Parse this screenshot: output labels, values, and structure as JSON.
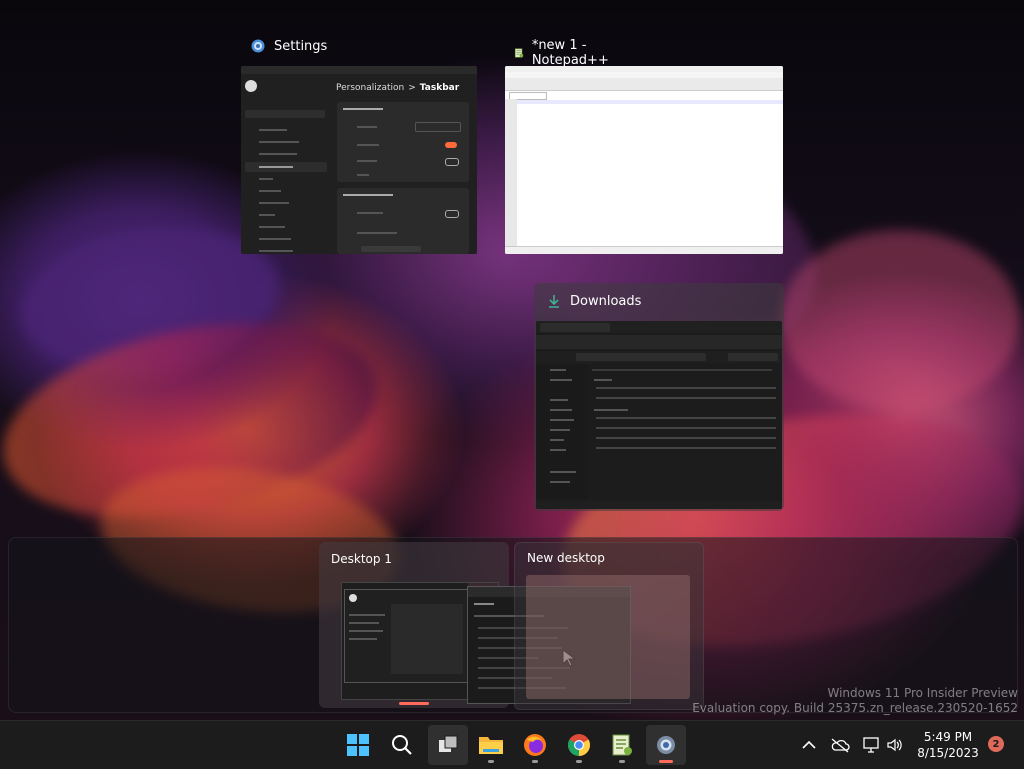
{
  "windows": [
    {
      "title": "Settings",
      "icon": "gear-icon"
    },
    {
      "title": "*new 1 - Notepad++",
      "icon": "notepadpp-icon"
    },
    {
      "title": "Downloads",
      "icon": "download-icon"
    }
  ],
  "settings_preview": {
    "breadcrumb_section": "Personalization",
    "breadcrumb_separator": ">",
    "breadcrumb_page": "Taskbar"
  },
  "desktops": [
    {
      "label": "Desktop 1"
    },
    {
      "label": "New desktop"
    }
  ],
  "watermark": {
    "line1": "Windows 11 Pro Insider Preview",
    "line2": "Evaluation copy. Build 25375.zn_release.230520-1652"
  },
  "taskbar": {
    "items": [
      "start-icon",
      "search-icon",
      "task-view-icon",
      "file-explorer-icon",
      "firefox-icon",
      "chrome-icon",
      "notepadpp-icon",
      "settings-icon"
    ],
    "accent_color": "#ff6a5c"
  },
  "tray": {
    "time": "5:49 PM",
    "date": "8/15/2023",
    "notification_count": "2"
  }
}
